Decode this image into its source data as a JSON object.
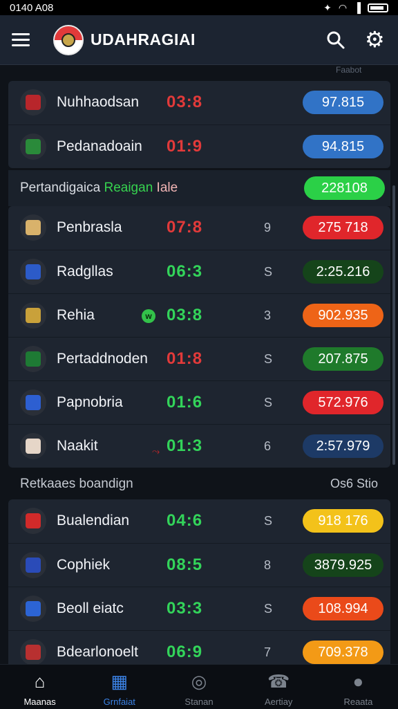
{
  "status_bar": {
    "time": "0140 A08",
    "bluetooth": "bluetooth-icon",
    "wifi": "wifi-icon",
    "signal": "signal-icon",
    "battery": "battery-icon"
  },
  "app_bar": {
    "title": "UDAHRAGIAI",
    "menu_icon": "menu-icon",
    "search_icon": "search-icon",
    "settings_icon": "gear-icon"
  },
  "scroll_hint": "Faabot",
  "group1": [
    {
      "team": "Nuhhaodsan",
      "score": "03:8",
      "score_color": "red",
      "mid": "",
      "odds": "97.815",
      "pill": "blue",
      "badge": "#b8262b"
    },
    {
      "team": "Pedanadoain",
      "score": "01:9",
      "score_color": "red",
      "mid": "",
      "odds": "94.815",
      "pill": "blue",
      "badge": "#2a8a3a"
    }
  ],
  "section1": {
    "prefix": "Pertandigaica",
    "highlight": "Reaigan",
    "suffix": "Iale",
    "pill": "228108"
  },
  "group2": [
    {
      "team": "Penbrasla",
      "score": "07:8",
      "score_color": "red",
      "mid": "9",
      "odds": "275 718",
      "pill": "red",
      "badge": "#d9b26b"
    },
    {
      "team": "Radgllas",
      "score": "06:3",
      "score_color": "green",
      "mid": "S",
      "odds": "2:25.216",
      "pill": "darkgreen",
      "badge": "#2c5bc8"
    },
    {
      "team": "Rehia",
      "score": "03:8",
      "score_color": "green",
      "mid": "3",
      "odds": "902.935",
      "pill": "orange",
      "badge": "#c9a13a",
      "live": "w"
    },
    {
      "team": "Pertaddnoden",
      "score": "01:8",
      "score_color": "red",
      "mid": "S",
      "odds": "207.875",
      "pill": "green",
      "badge": "#1e7a34"
    },
    {
      "team": "Papnobria",
      "score": "01:6",
      "score_color": "green",
      "mid": "S",
      "odds": "572.976",
      "pill": "red",
      "badge": "#2d5fd1"
    },
    {
      "team": "Naakit",
      "score": "01:3",
      "score_color": "green",
      "mid": "6",
      "odds": "2:57.979",
      "pill": "navy",
      "badge": "#e6d6c8",
      "mark": "⤳"
    }
  ],
  "section2": {
    "title": "Retkaaes boandign",
    "right": "Os6 Stio"
  },
  "group3": [
    {
      "team": "Bualendian",
      "score": "04:6",
      "score_color": "green",
      "mid": "S",
      "odds": "918 176",
      "pill": "yellow",
      "badge": "#d12a2a"
    },
    {
      "team": "Cophiek",
      "score": "08:5",
      "score_color": "green",
      "mid": "8",
      "odds": "3879.925",
      "pill": "darkgreen",
      "badge": "#2a4bb8"
    },
    {
      "team": "Beoll eiatc",
      "score": "03:3",
      "score_color": "green",
      "mid": "S",
      "odds": "108.994",
      "pill": "orangered",
      "badge": "#2c64d4"
    },
    {
      "team": "Bdearlonoelt",
      "score": "06:9",
      "score_color": "green",
      "mid": "7",
      "odds": "709.378",
      "pill": "amber",
      "badge": "#b83030"
    }
  ],
  "bottom_nav": [
    {
      "label": "Maanas",
      "icon": "home-icon",
      "color": "#ffffff"
    },
    {
      "label": "Grnfaiat",
      "icon": "calendar-icon",
      "color": "#3c83e6"
    },
    {
      "label": "Stanan",
      "icon": "ball-icon",
      "color": "#7c838d"
    },
    {
      "label": "Aertiay",
      "icon": "phone-icon",
      "color": "#7c838d"
    },
    {
      "label": "Reaata",
      "icon": "profile-icon",
      "color": "#7c838d"
    }
  ]
}
